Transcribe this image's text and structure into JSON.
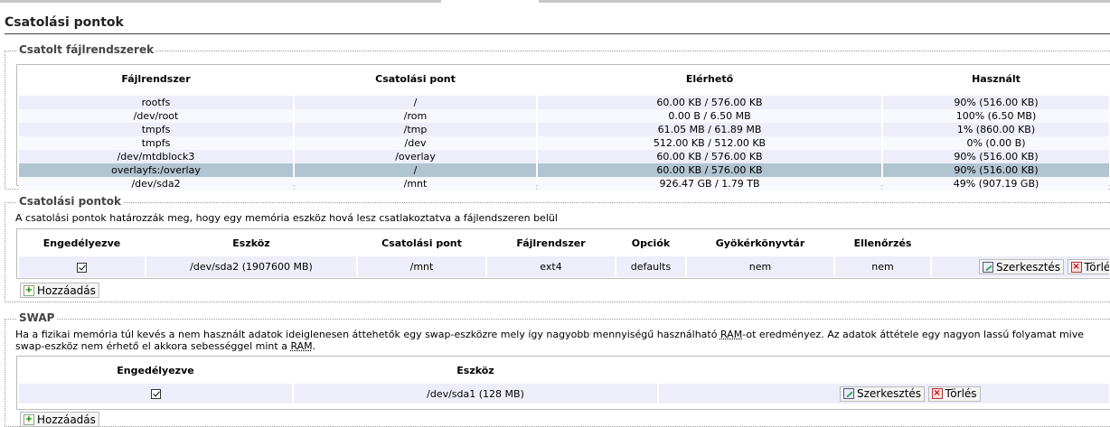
{
  "page_title": "Csatolási pontok",
  "mounted": {
    "legend": "Csatolt fájlrendszerek",
    "headers": [
      "Fájlrendszer",
      "Csatolási pont",
      "Elérhető",
      "Használt"
    ],
    "rows": [
      [
        "rootfs",
        "/",
        "60.00 KB / 576.00 KB",
        "90% (516.00 KB)"
      ],
      [
        "/dev/root",
        "/rom",
        "0.00 B / 6.50 MB",
        "100% (6.50 MB)"
      ],
      [
        "tmpfs",
        "/tmp",
        "61.05 MB / 61.89 MB",
        "1% (860.00 KB)"
      ],
      [
        "tmpfs",
        "/dev",
        "512.00 KB / 512.00 KB",
        "0% (0.00 B)"
      ],
      [
        "/dev/mtdblock3",
        "/overlay",
        "60.00 KB / 576.00 KB",
        "90% (516.00 KB)"
      ],
      [
        "overlayfs:/overlay",
        "/",
        "60.00 KB / 576.00 KB",
        "90% (516.00 KB)"
      ],
      [
        "/dev/sda2",
        "/mnt",
        "926.47 GB / 1.79 TB",
        "49% (907.19 GB)"
      ]
    ]
  },
  "mountpoints": {
    "legend": "Csatolási pontok",
    "description": "A csatolási pontok határozzák meg, hogy egy memória eszköz hová lesz csatlakoztatva a fájlendszeren belül",
    "headers": [
      "Engedélyezve",
      "Eszköz",
      "Csatolási pont",
      "Fájlrendszer",
      "Opciók",
      "Gyökérkönyvtár",
      "Ellenőrzés"
    ],
    "row": {
      "device": "/dev/sda2 (1907600 MB)",
      "mountpoint": "/mnt",
      "fs": "ext4",
      "options": "defaults",
      "root": "nem",
      "check": "nem"
    },
    "edit_label": "Szerkesztés",
    "delete_label": "Törlés",
    "add_label": "Hozzáadás"
  },
  "swap": {
    "legend": "SWAP",
    "desc1_a": "Ha a fizikai memória túl kevés a nem használt adatok ideiglenesen áttehetők egy swap-eszközre mely így nagyobb mennyiségű használható ",
    "desc1_ram": "RAM",
    "desc1_b": "-ot eredményez. Az adatok áttétele egy nagyon lassú folyamat mive",
    "desc2_a": "swap-eszköz nem érhető el akkora sebességgel mint a ",
    "desc2_ram": "RAM",
    "desc2_b": ".",
    "headers": [
      "Engedélyezve",
      "Eszköz"
    ],
    "row": {
      "device": "/dev/sda1 (128 MB)"
    },
    "edit_label": "Szerkesztés",
    "delete_label": "Törlés",
    "add_label": "Hozzáadás"
  }
}
